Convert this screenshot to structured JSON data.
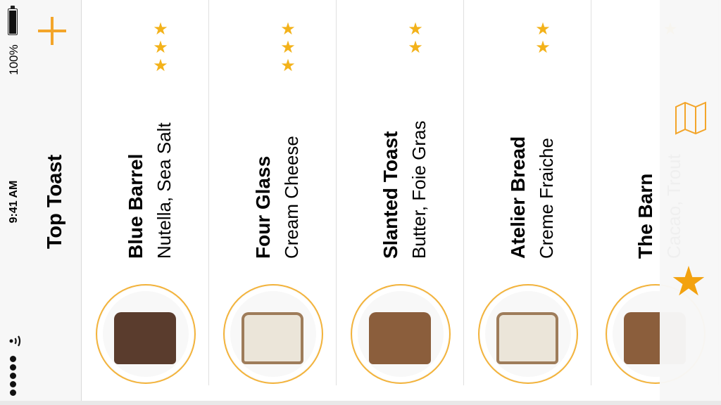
{
  "status": {
    "battery": "100%",
    "time": "9:41 AM"
  },
  "header": {
    "title": "Top Toast",
    "add_icon": "plus-icon"
  },
  "cards": [
    {
      "name": "Blue Barrel",
      "toppings": "Nutella, Sea Salt",
      "rating": 3,
      "toast": "nutella"
    },
    {
      "name": "Four Glass",
      "toppings": "Cream Cheese",
      "rating": 3,
      "toast": "cheese"
    },
    {
      "name": "Slanted Toast",
      "toppings": "Butter, Foie Gras",
      "rating": 2,
      "toast": "plain"
    },
    {
      "name": "Atelier Bread",
      "toppings": "Creme Fraiche",
      "rating": 2,
      "toast": "cheese"
    },
    {
      "name": "The Barn",
      "toppings": "Cacao, Trout",
      "rating": 1,
      "toast": "plain"
    }
  ],
  "sidebar": {
    "map_icon": "map-icon",
    "favorites_icon": "star-icon"
  },
  "colors": {
    "accent": "#f3a52a",
    "star": "#f3b21a"
  }
}
